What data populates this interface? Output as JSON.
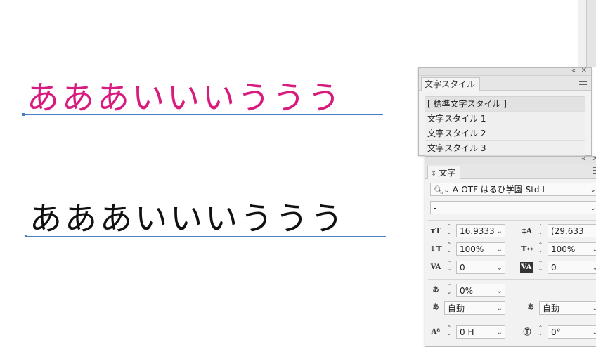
{
  "canvas": {
    "line1": {
      "text": "あああいいいううう",
      "color": "#d81b7e"
    },
    "line2": {
      "text": "あああいいいううう",
      "color": "#111111"
    }
  },
  "style_panel": {
    "tab": "文字スタイル",
    "items": [
      "[ 標準文字スタイル ]",
      "文字スタイル 1",
      "文字スタイル 2",
      "文字スタイル 3"
    ],
    "collapse_icon": "«",
    "close_icon": "✕"
  },
  "char_panel": {
    "tab": "文字",
    "tab_icon": "⇕",
    "font_family": "A-OTF はるひ学園 Std L",
    "font_style": "-",
    "font_size": "16.9333",
    "leading": "(29.633",
    "vertical_scale": "100%",
    "horizontal_scale": "100%",
    "kerning": "0",
    "tracking": "0",
    "tsume": "0%",
    "aki_before": "自動",
    "aki_after": "自動",
    "baseline_shift": "0 H",
    "rotation": "0°",
    "collapse_icon": "«",
    "close_icon": "✕"
  }
}
